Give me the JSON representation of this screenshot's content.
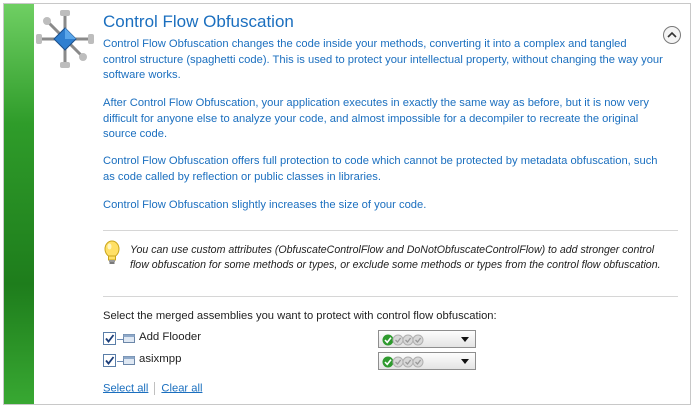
{
  "section": {
    "title": "Control Flow Obfuscation",
    "icon": "cross-molecule-icon",
    "collapse_icon": "chevron-up-icon",
    "paragraphs": [
      "Control Flow Obfuscation changes the code inside your methods, converting it into a complex and tangled control structure (spaghetti code). This is used to protect your intellectual property, without changing the way your software works.",
      "After Control Flow Obfuscation, your application executes in exactly the same way as before, but it is now very difficult for anyone else to analyze your code, and almost impossible for a decompiler to recreate the original source code.",
      "Control Flow Obfuscation offers full protection to code which cannot be protected by metadata obfuscation, such as code called by reflection or public classes in libraries.",
      "Control Flow Obfuscation slightly increases the size of your code."
    ]
  },
  "tip": {
    "icon": "lightbulb-icon",
    "text": "You can use custom attributes (ObfuscateControlFlow and DoNotObfuscateControlFlow) to add stronger control flow obfuscation for some methods or types, or exclude some methods or types from the control flow obfuscation."
  },
  "assemblies": {
    "label": "Select the merged assemblies you want to protect with control flow obfuscation:",
    "items": [
      {
        "name": "Add Flooder",
        "checked": true,
        "level": 1
      },
      {
        "name": "asixmpp",
        "checked": true,
        "level": 1
      }
    ],
    "level_max": 4
  },
  "links": {
    "select_all": "Select all",
    "clear_all": "Clear all"
  },
  "colors": {
    "accent": "#1b6fbf",
    "sidebar_green": "#2f9c2a",
    "check_green": "#2e9a2e"
  }
}
